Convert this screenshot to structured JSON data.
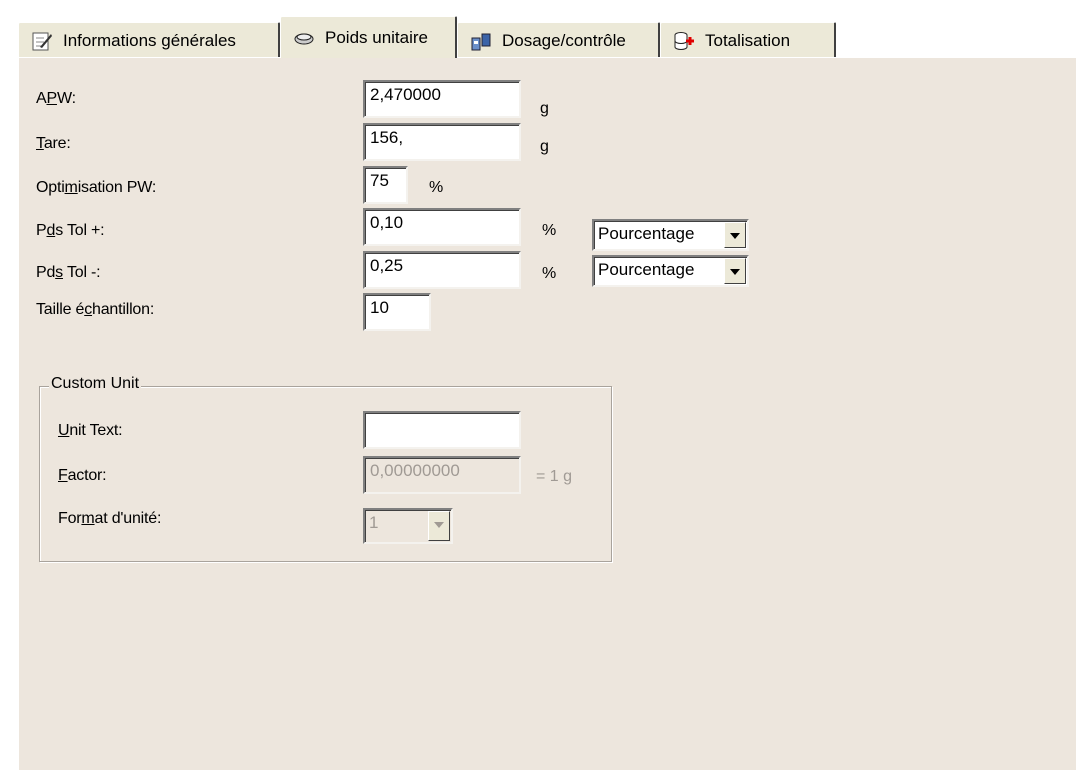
{
  "tabs": [
    {
      "label": "Informations générales",
      "icon": "note-pencil-icon"
    },
    {
      "label": "Poids unitaire",
      "icon": "weight-icon",
      "active": true
    },
    {
      "label": "Dosage/contrôle",
      "icon": "containers-icon"
    },
    {
      "label": "Totalisation",
      "icon": "database-add-icon"
    }
  ],
  "form": {
    "apw": {
      "label": "APW:",
      "value": "2,470000",
      "unit": "g"
    },
    "tare": {
      "label": "Tare:",
      "value": "156,",
      "unit": "g"
    },
    "optim": {
      "label": "Optimisation PW:",
      "value": "75",
      "unit": "%"
    },
    "tol_plus": {
      "label": "Pds Tol +:",
      "value": "0,10",
      "unit": "%",
      "mode": "Pourcentage"
    },
    "tol_minus": {
      "label": "Pds Tol -:",
      "value": "0,25",
      "unit": "%",
      "mode": "Pourcentage"
    },
    "sample": {
      "label": "Taille échantillon:",
      "value": "10"
    }
  },
  "custom_unit": {
    "title": "Custom Unit",
    "unit_text": {
      "label": "Unit Text:",
      "value": ""
    },
    "factor": {
      "label": "Factor:",
      "value": "0,00000000",
      "suffix": "= 1 g"
    },
    "format": {
      "label": "Format d'unité:",
      "value": "1"
    }
  }
}
